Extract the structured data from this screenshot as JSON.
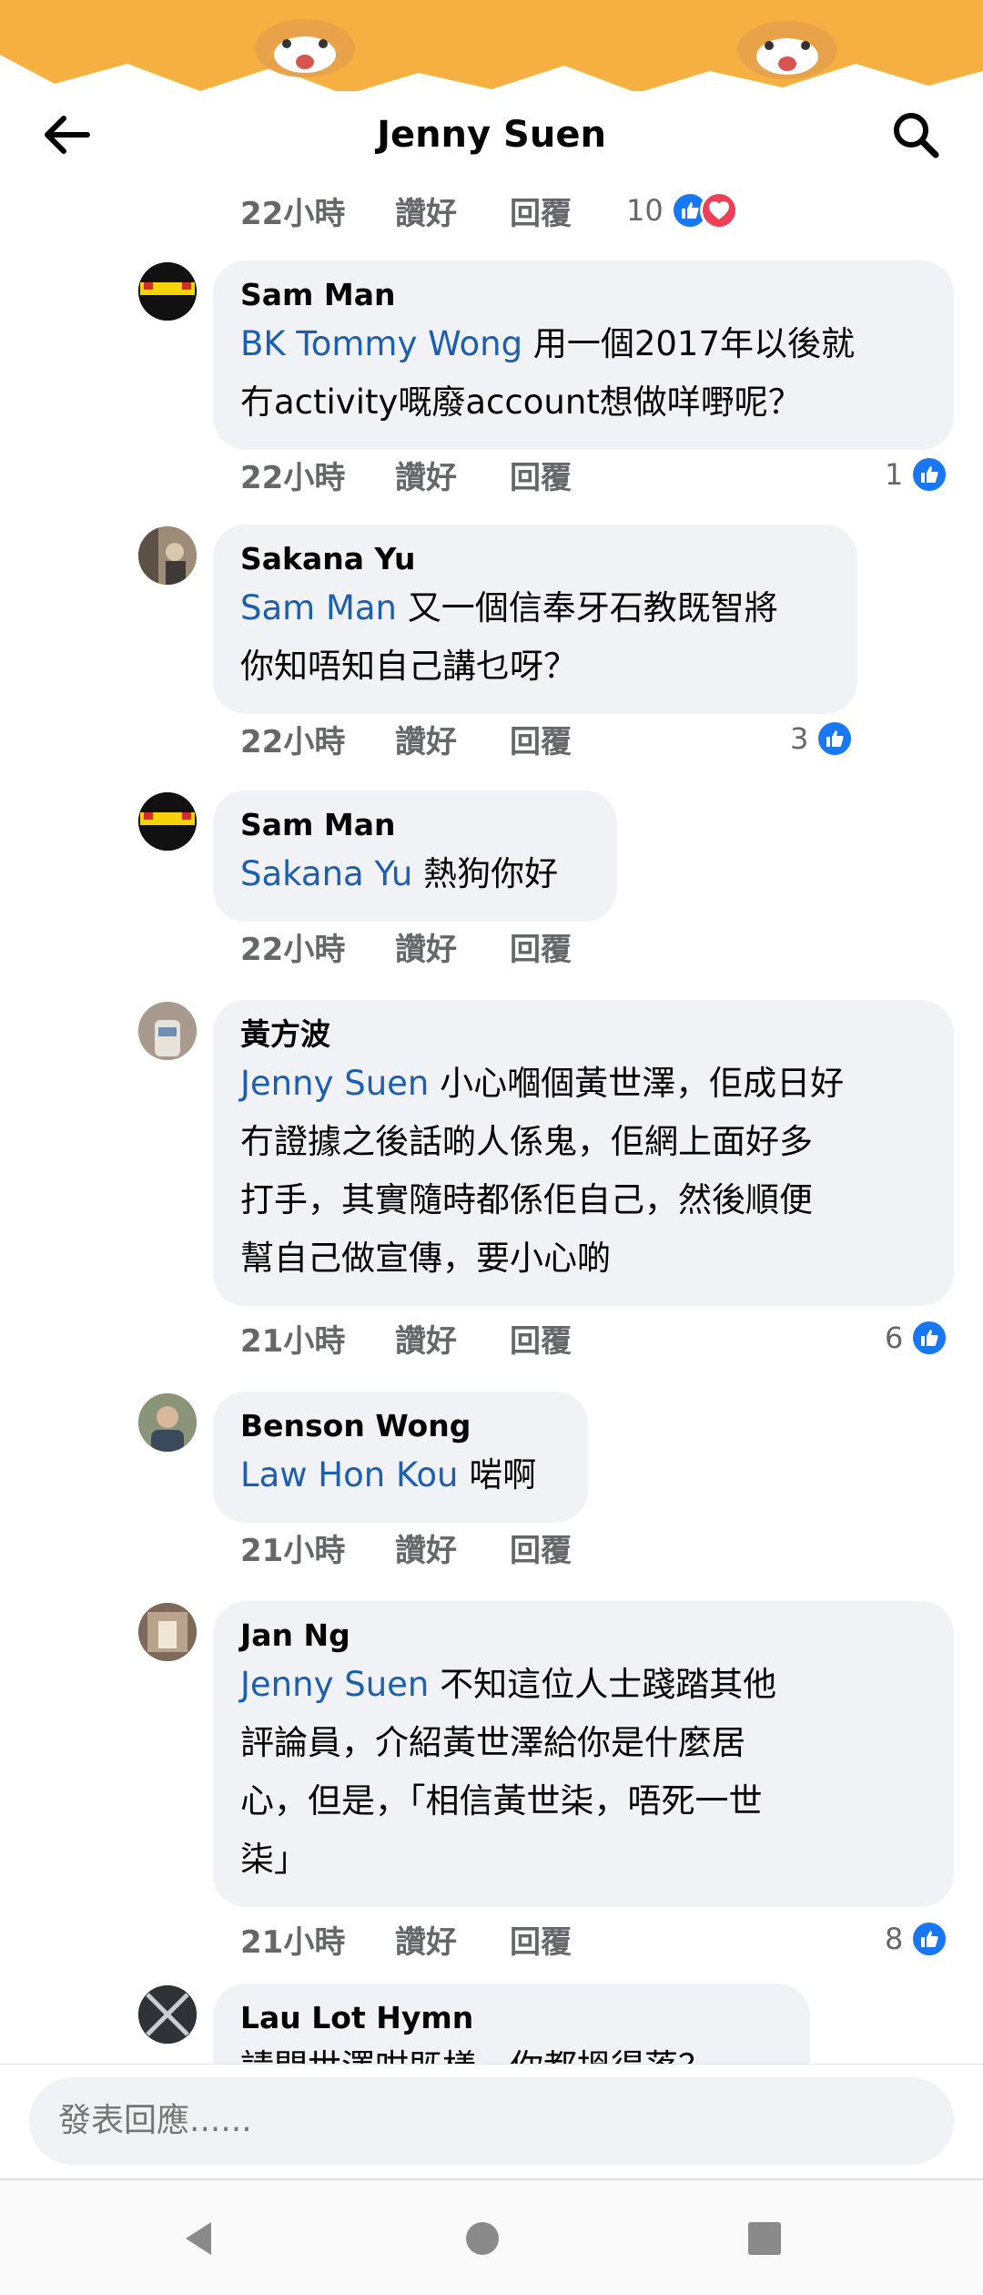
{
  "header": {
    "title": "Jenny Suen",
    "back_icon": "arrow-left-icon",
    "search_icon": "search-icon"
  },
  "colors": {
    "banner": "#f5b041",
    "mention": "#1c5fb0",
    "like": "#1877f2",
    "heart": "#f33e58",
    "bubble": "#f0f2f5"
  },
  "top_actions": {
    "time": "22小時",
    "like": "讚好",
    "reply": "回覆",
    "reactions": "10"
  },
  "comments": [
    {
      "name": "Sam Man",
      "mention": "BK Tommy Wong",
      "line1": " 用一個2017年以後就",
      "lines": [
        "冇activity嘅廢account想做咩嘢呢？"
      ],
      "time": "22小時",
      "like": "讚好",
      "reply": "回覆",
      "reactions": "1"
    },
    {
      "name": "Sakana Yu",
      "mention": "Sam Man",
      "line1": " 又一個信奉牙石教既智將",
      "lines": [
        "你知唔知自己講乜呀？"
      ],
      "time": "22小時",
      "like": "讚好",
      "reply": "回覆",
      "reactions": "3"
    },
    {
      "name": "Sam Man",
      "mention": "Sakana Yu",
      "line1": " 熱狗你好",
      "lines": [],
      "time": "22小時",
      "like": "讚好",
      "reply": "回覆",
      "reactions": ""
    },
    {
      "name": "黃方波",
      "mention": "Jenny Suen",
      "line1": " 小心嗰個黃世澤，佢成日好",
      "lines": [
        "冇證據之後話啲人係鬼，佢網上面好多",
        "打手，其實隨時都係佢自己，然後順便",
        "幫自己做宣傳，要小心啲￼￼"
      ],
      "time": "21小時",
      "like": "讚好",
      "reply": "回覆",
      "reactions": "6"
    },
    {
      "name": "Benson Wong",
      "mention": "Law Hon Kou",
      "line1": " 啱啊",
      "lines": [],
      "time": "21小時",
      "like": "讚好",
      "reply": "回覆",
      "reactions": ""
    },
    {
      "name": "Jan Ng",
      "mention": "Jenny Suen",
      "line1": " ￼不知這位人士￼踐踏其他",
      "lines": [
        "評論員，￼介紹￼黃世澤給你是什麼居",
        "心，但是，「相信黃世柒，唔死一世",
        "柒」"
      ],
      "time": "21小時",
      "like": "讚好",
      "reply": "回覆",
      "reactions": "8"
    },
    {
      "name": "Lau Lot Hymn",
      "mention": "",
      "line1": "",
      "lines": [
        "請問世澤咁既樣，你都搵得落？"
      ],
      "time": "",
      "like": "",
      "reply": "",
      "reactions": ""
    }
  ],
  "composer": {
    "placeholder": "發表回應......"
  },
  "navbar": {
    "back": "nav-back-icon",
    "home": "nav-home-icon",
    "recents": "nav-recents-icon"
  }
}
